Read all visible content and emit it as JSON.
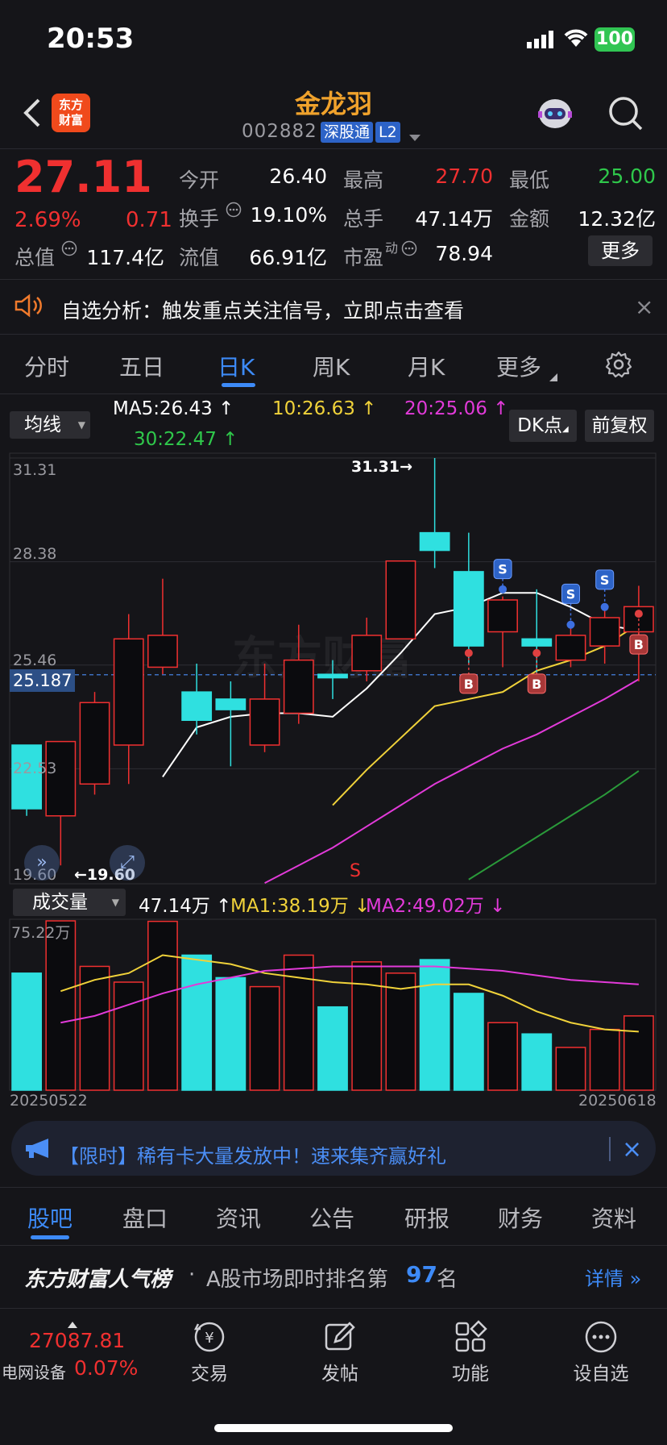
{
  "status_bar": {
    "time": "20:53",
    "battery": "100"
  },
  "header": {
    "logo": "东方\n财富",
    "title": "金龙羽",
    "code": "002882",
    "tag1": "深股通",
    "tag2": "L2"
  },
  "quote": {
    "price": "27.11",
    "pct": "2.69%",
    "change": "0.71",
    "open_label": "今开",
    "open": "26.40",
    "high_label": "最高",
    "high": "27.70",
    "low_label": "最低",
    "low": "25.00",
    "turnover_label": "换手",
    "turnover": "19.10%",
    "volume_label": "总手",
    "volume": "47.14万",
    "amount_label": "金额",
    "amount": "12.32亿",
    "mktcap_label": "总值",
    "mktcap": "117.4亿",
    "float_label": "流值",
    "float": "66.91亿",
    "pe_label": "市盈",
    "pe_super": "动",
    "pe": "78.94",
    "more": "更多"
  },
  "alert": {
    "text": "自选分析：触发重点关注信号，立即点击查看",
    "close": "×"
  },
  "tabs": [
    "分时",
    "五日",
    "日K",
    "周K",
    "月K",
    "更多",
    "gear-icon"
  ],
  "chart_toolbar": {
    "ma_select": "均线",
    "ma5": "MA5:26.43",
    "ma10": "10:26.63",
    "ma20": "20:25.06",
    "ma30": "30:22.47",
    "dk": "DK点",
    "adjust": "前复权"
  },
  "chart_axes": {
    "y1": "31.31",
    "y2": "28.38",
    "y3": "25.46",
    "y4": "22.53",
    "y5": "19.60",
    "current": "25.187",
    "max_note": "31.31→",
    "min_note": "←19.60",
    "vol_select": "成交量",
    "vol_now": "47.14万",
    "ma1": "MA1:38.19万",
    "ma2": "MA2:49.02万",
    "vol_max": "75.22万",
    "date_start": "20250522",
    "date_end": "20250618"
  },
  "chart_data": {
    "type": "candlestick",
    "candles": [
      {
        "o": 23.2,
        "c": 21.4,
        "h": 23.2,
        "l": 21.2
      },
      {
        "o": 21.2,
        "c": 23.3,
        "h": 23.3,
        "l": 19.8
      },
      {
        "o": 22.1,
        "c": 24.4,
        "h": 24.7,
        "l": 21.8
      },
      {
        "o": 23.2,
        "c": 26.2,
        "h": 26.9,
        "l": 22.1
      },
      {
        "o": 25.4,
        "c": 26.3,
        "h": 27.9,
        "l": 25.2
      },
      {
        "o": 24.7,
        "c": 23.9,
        "h": 25.5,
        "l": 23.5
      },
      {
        "o": 24.5,
        "c": 24.2,
        "h": 25.0,
        "l": 22.6
      },
      {
        "o": 23.2,
        "c": 24.5,
        "h": 25.5,
        "l": 23.0
      },
      {
        "o": 24.1,
        "c": 25.6,
        "h": 26.6,
        "l": 23.8
      },
      {
        "o": 25.2,
        "c": 25.1,
        "h": 25.6,
        "l": 24.5
      },
      {
        "o": 25.3,
        "c": 26.3,
        "h": 26.8,
        "l": 25.0
      },
      {
        "o": 26.2,
        "c": 28.4,
        "h": 28.4,
        "l": 26.2
      },
      {
        "o": 29.2,
        "c": 28.7,
        "h": 31.31,
        "l": 28.2
      },
      {
        "o": 28.1,
        "c": 26.0,
        "h": 29.2,
        "l": 25.5
      },
      {
        "o": 26.4,
        "c": 27.3,
        "h": 27.4,
        "l": 25.4
      },
      {
        "o": 26.2,
        "c": 26.0,
        "h": 27.6,
        "l": 25.0
      },
      {
        "o": 25.6,
        "c": 26.3,
        "h": 26.7,
        "l": 25.4
      },
      {
        "o": 26.0,
        "c": 26.8,
        "h": 27.1,
        "l": 25.5
      },
      {
        "o": 26.4,
        "c": 27.11,
        "h": 27.7,
        "l": 25.0
      }
    ],
    "ma": {
      "MA5": {
        "color": "#ffffff",
        "values": [
          null,
          null,
          null,
          null,
          22.3,
          23.7,
          24.0,
          24.1,
          24.1,
          24.0,
          24.8,
          25.8,
          26.9,
          27.1,
          27.5,
          27.5,
          27.1,
          26.6,
          26.43
        ]
      },
      "MA10": {
        "color": "#f0d23a",
        "values": [
          null,
          null,
          null,
          null,
          null,
          null,
          null,
          null,
          null,
          21.5,
          22.5,
          23.4,
          24.3,
          24.5,
          24.7,
          25.3,
          25.6,
          26.0,
          26.63
        ]
      },
      "MA20": {
        "color": "#e23ad9",
        "values": [
          null,
          null,
          null,
          null,
          null,
          null,
          null,
          19.3,
          19.8,
          20.3,
          20.9,
          21.5,
          22.1,
          22.6,
          23.1,
          23.5,
          24.0,
          24.5,
          25.06
        ]
      },
      "MA30": {
        "color": "#2a9a3a",
        "values": [
          null,
          null,
          null,
          null,
          null,
          null,
          null,
          null,
          null,
          null,
          null,
          null,
          null,
          19.4,
          20.0,
          20.6,
          21.2,
          21.8,
          22.47
        ]
      }
    },
    "ylim": [
      19.6,
      31.31
    ],
    "signals": [
      {
        "i": 13,
        "type": "B"
      },
      {
        "i": 14,
        "type": "S"
      },
      {
        "i": 15,
        "type": "B"
      },
      {
        "i": 16,
        "type": "S"
      },
      {
        "i": 17,
        "type": "S"
      },
      {
        "i": 18,
        "type": "B"
      }
    ],
    "volume": [
      52,
      75.22,
      55,
      48,
      75,
      60,
      50,
      46,
      60,
      37,
      57,
      52,
      58,
      43,
      30,
      25,
      19,
      27,
      33
    ],
    "vol_ma1": [
      null,
      44,
      49,
      52,
      60,
      58,
      56,
      52,
      50,
      48,
      47,
      45,
      47,
      47,
      42,
      35,
      30,
      27,
      26
    ],
    "vol_ma2": [
      null,
      30,
      33,
      38,
      43,
      47,
      50,
      53,
      54,
      55,
      55,
      55,
      55,
      54,
      53,
      51,
      49,
      48,
      47
    ]
  },
  "promo": {
    "text": "【限时】稀有卡大量发放中！速来集齐赢好礼",
    "close": "×"
  },
  "bottom_tabs": [
    "股吧",
    "盘口",
    "资讯",
    "公告",
    "研报",
    "财务",
    "资料"
  ],
  "ranking": {
    "brand": "东方财富人气榜",
    "dot": "·",
    "text_pre": "A股市场即时排名第",
    "rank": "97",
    "text_post": "名",
    "detail": "详情"
  },
  "bottom_nav": {
    "index_value": "27087.81",
    "index_name": "电网设备",
    "index_pct": "0.07%",
    "items": [
      "交易",
      "发帖",
      "功能",
      "设自选"
    ]
  }
}
